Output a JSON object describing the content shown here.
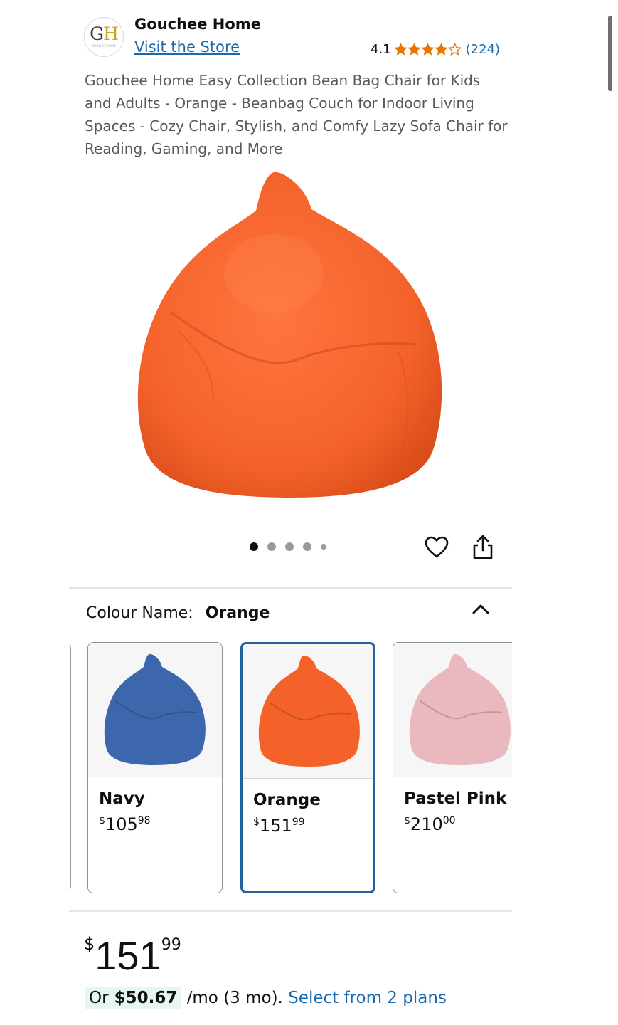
{
  "brand": {
    "name": "Gouchee Home",
    "logo_letters": "GH",
    "logo_subtext": "GOUCHEE HOME",
    "visit_store": "Visit the Store",
    "rating": "4.1",
    "stars": 4.1,
    "review_count": "(224)"
  },
  "product": {
    "title": "Gouchee Home Easy Collection Bean Bag Chair for Kids and Adults - Orange - Beanbag Couch for Indoor Living Spaces - Cozy Chair, Stylish, and Comfy Lazy Sofa Chair for Reading, Gaming, and More",
    "image_color": "#f4622a",
    "image_count": 5,
    "active_image": 0
  },
  "actions": {
    "favorite_icon": "heart-icon",
    "share_icon": "share-icon"
  },
  "colour": {
    "label": "Colour Name:",
    "selected": "Orange",
    "expanded": true,
    "options": [
      {
        "name": "Navy",
        "currency": "$",
        "whole": "105",
        "fraction": "98",
        "color": "#3c67ad",
        "selected": false
      },
      {
        "name": "Orange",
        "currency": "$",
        "whole": "151",
        "fraction": "99",
        "color": "#f4622a",
        "selected": true
      },
      {
        "name": "Pastel Pink",
        "currency": "$",
        "whole": "210",
        "fraction": "00",
        "color": "#e9b9bf",
        "selected": false
      }
    ]
  },
  "price": {
    "currency": "$",
    "whole": "151",
    "fraction": "99"
  },
  "installment": {
    "prefix": "Or",
    "amount": "$50.67",
    "terms": "/mo (3 mo).",
    "link": "Select from 2 plans"
  },
  "colors": {
    "link": "#1a6ab1",
    "star": "#e77600",
    "selected_border": "#2162a1"
  }
}
